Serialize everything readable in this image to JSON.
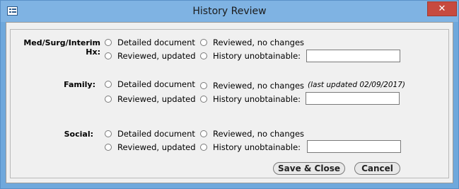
{
  "window": {
    "title": "History Review",
    "close_glyph": "✕"
  },
  "options": {
    "detailed": "Detailed document",
    "reviewed_no_changes": "Reviewed, no changes",
    "reviewed_updated": "Reviewed, updated",
    "unobtainable": "History unobtainable:"
  },
  "sections": {
    "med": {
      "label": "Med/Surg/Interim Hx:"
    },
    "family": {
      "label": "Family:",
      "note": "(last updated 02/09/2017)"
    },
    "social": {
      "label": "Social:"
    }
  },
  "buttons": {
    "save_close": "Save & Close",
    "cancel": "Cancel"
  },
  "colors": {
    "titlebar": "#7fb3e3",
    "close": "#c74a3f",
    "background": "#f0f0f0"
  }
}
